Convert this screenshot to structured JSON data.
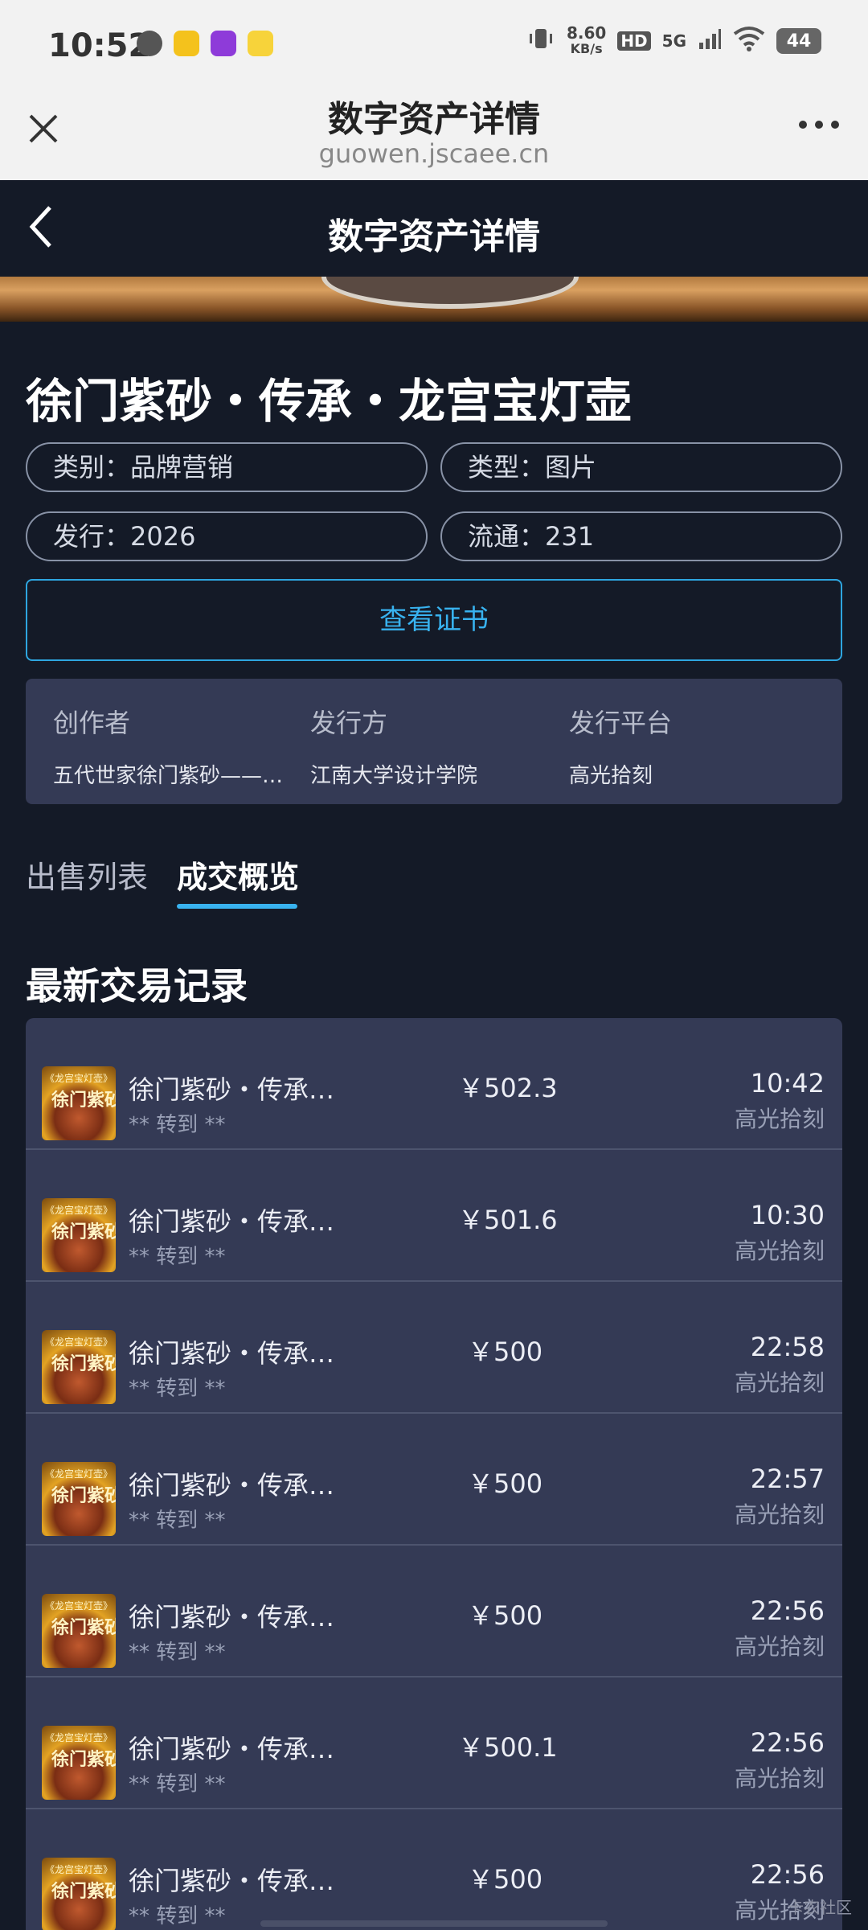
{
  "status_bar": {
    "time": "10:52",
    "net_speed_value": "8.60",
    "net_speed_unit": "KB/s",
    "hd": "HD",
    "network": "5G",
    "battery": "44"
  },
  "browser": {
    "title": "数字资产详情",
    "url": "guowen.jscaee.cn"
  },
  "page": {
    "title": "数字资产详情"
  },
  "asset": {
    "name": "徐门紫砂・传承・龙宫宝灯壶",
    "category": "类别：品牌营销",
    "type": "类型：图片",
    "issue": "发行：2026",
    "circulation": "流通：231",
    "certificate_button": "查看证书"
  },
  "info": {
    "creator_label": "创作者",
    "creator_value": "五代世家徐门紫砂——…",
    "issuer_label": "发行方",
    "issuer_value": "江南大学设计学院",
    "platform_label": "发行平台",
    "platform_value": "高光拾刻"
  },
  "tabs": {
    "sale_list": "出售列表",
    "overview": "成交概览"
  },
  "section_title": "最新交易记录",
  "thumb_text": {
    "small": "《龙宫宝灯壶》",
    "large": "徐门紫砂"
  },
  "records": [
    {
      "name": "徐门紫砂・传承…",
      "sub": "** 转到 **",
      "price": "￥502.3",
      "time": "10:42",
      "platform": "高光拾刻"
    },
    {
      "name": "徐门紫砂・传承…",
      "sub": "** 转到 **",
      "price": "￥501.6",
      "time": "10:30",
      "platform": "高光拾刻"
    },
    {
      "name": "徐门紫砂・传承…",
      "sub": "** 转到 **",
      "price": "￥500",
      "time": "22:58",
      "platform": "高光拾刻"
    },
    {
      "name": "徐门紫砂・传承…",
      "sub": "** 转到 **",
      "price": "￥500",
      "time": "22:57",
      "platform": "高光拾刻"
    },
    {
      "name": "徐门紫砂・传承…",
      "sub": "** 转到 **",
      "price": "￥500",
      "time": "22:56",
      "platform": "高光拾刻"
    },
    {
      "name": "徐门紫砂・传承…",
      "sub": "** 转到 **",
      "price": "￥500.1",
      "time": "22:56",
      "platform": "高光拾刻"
    },
    {
      "name": "徐门紫砂・传承…",
      "sub": "** 转到 **",
      "price": "￥500",
      "time": "22:56",
      "platform": "高光拾刻"
    }
  ],
  "watermark": "卡农社区"
}
